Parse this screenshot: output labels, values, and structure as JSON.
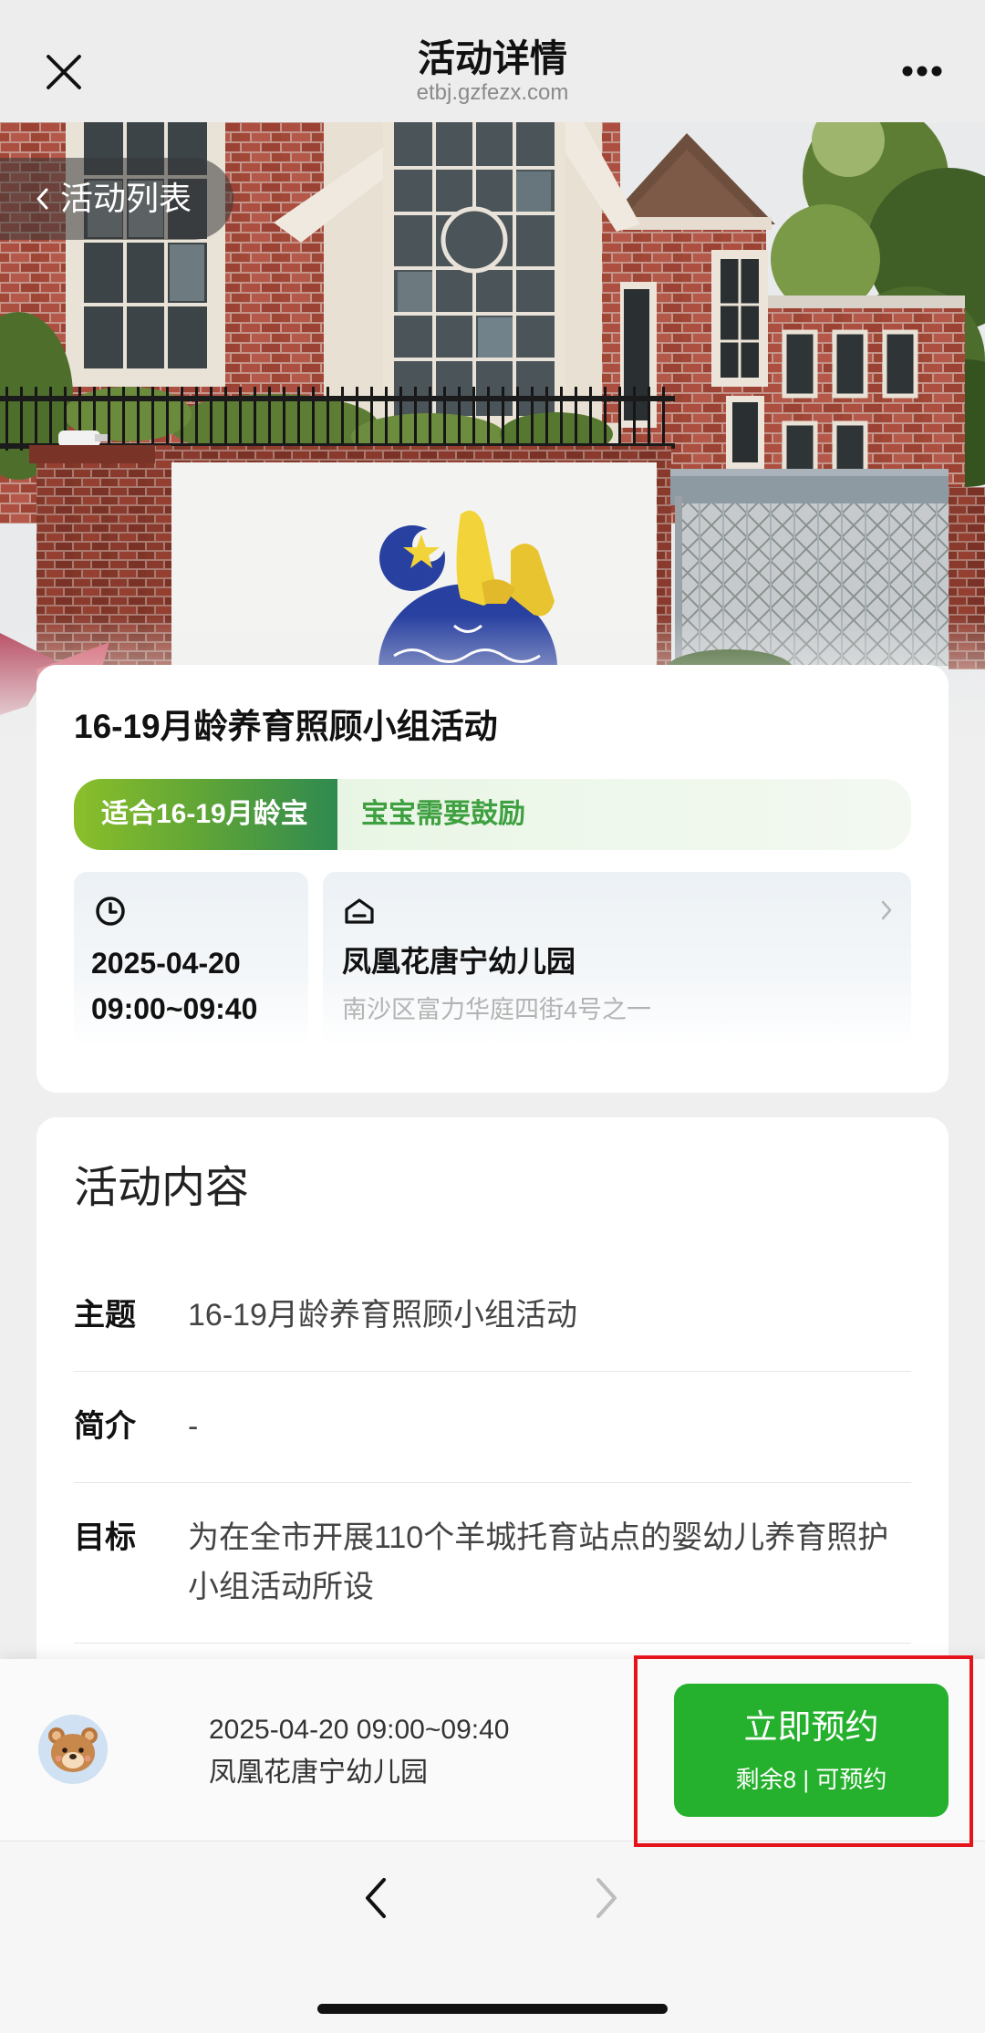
{
  "nav": {
    "title": "活动详情",
    "url": "etbj.gzfezx.com"
  },
  "hero": {
    "back_label": "活动列表"
  },
  "summary": {
    "title": "16-19月龄养育照顾小组活动",
    "tags": {
      "age": "适合16-19月龄宝",
      "note": "宝宝需要鼓励"
    },
    "date": "2025-04-20",
    "time": "09:00~09:40",
    "venue_name": "凤凰花唐宁幼儿园",
    "venue_address": "南沙区富力华庭四街4号之一"
  },
  "content": {
    "heading": "活动内容",
    "rows": [
      {
        "label": "主题",
        "value": "16-19月龄养育照顾小组活动"
      },
      {
        "label": "简介",
        "value": "-"
      },
      {
        "label": "目标",
        "value": "为在全市开展110个羊城托育站点的婴幼儿养育照护小组活动所设"
      }
    ]
  },
  "footer": {
    "datetime": "2025-04-20 09:00~09:40",
    "venue": "凤凰花唐宁幼儿园",
    "book_button": {
      "label": "立即预约",
      "status": "剩余8 | 可预约"
    }
  },
  "browser_nav": {
    "back_enabled": true,
    "forward_enabled": false
  },
  "icons": {
    "close": "close-icon",
    "more": "more-icon",
    "back": "chevron-left-icon",
    "clock": "clock-icon",
    "venue": "building-icon",
    "venue_link": "chevron-right-icon",
    "avatar": "bear-avatar",
    "browser_back": "chevron-left-icon",
    "browser_forward": "chevron-right-icon"
  },
  "colors": {
    "page_background": "#efefef",
    "accent_green": "#25b12d",
    "tag_green": "#3ea040",
    "highlight_red": "#e5141c",
    "disabled_gray": "#bdbdbd"
  }
}
